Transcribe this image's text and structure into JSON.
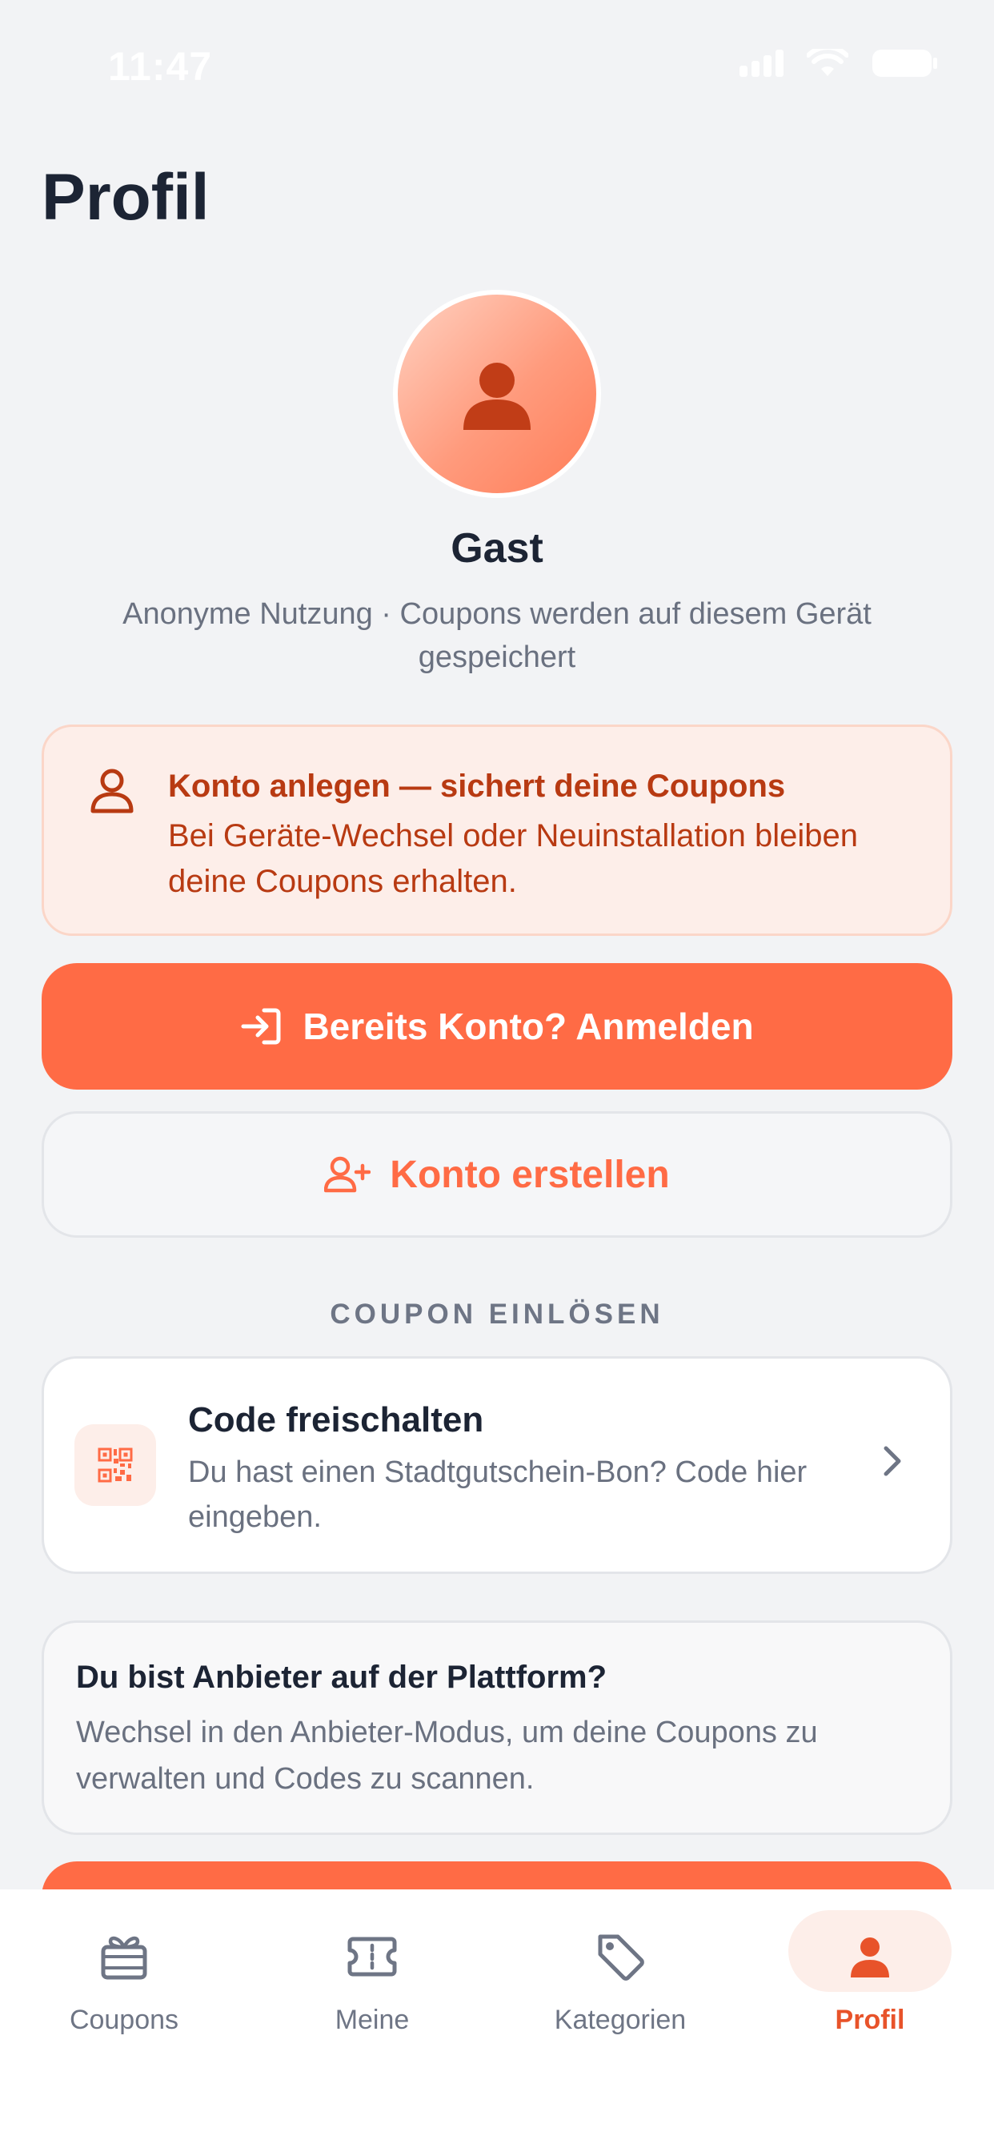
{
  "status_bar": {
    "time": "11:47"
  },
  "header": {
    "title": "Profil"
  },
  "profile": {
    "name": "Gast",
    "description": "Anonyme Nutzung · Coupons werden auf diesem Gerät gespeichert"
  },
  "notice": {
    "title": "Konto anlegen — sichert deine Coupons",
    "text": "Bei Geräte-Wechsel oder Neuinstallation bleiben deine Coupons erhalten."
  },
  "actions": {
    "login_label": "Bereits Konto? Anmelden",
    "signup_label": "Konto erstellen"
  },
  "redeem": {
    "section_label": "COUPON EINLÖSEN",
    "title": "Code freischalten",
    "text": "Du hast einen Stadtgutschein-Bon? Code hier eingeben."
  },
  "vendor": {
    "title": "Du bist Anbieter auf der Plattform?",
    "text": "Wechsel in den Anbieter-Modus, um deine Coupons zu verwalten und Codes zu scannen."
  },
  "tabbar": {
    "tabs": [
      {
        "label": "Coupons",
        "icon": "gift-icon"
      },
      {
        "label": "Meine",
        "icon": "ticket-icon"
      },
      {
        "label": "Kategorien",
        "icon": "tag-icon"
      },
      {
        "label": "Profil",
        "icon": "person-icon",
        "active": true
      }
    ]
  },
  "colors": {
    "accent": "#ff6b45",
    "accent_dark": "#b83a12",
    "accent_soft": "#fdeee9",
    "background": "#f2f3f5"
  }
}
